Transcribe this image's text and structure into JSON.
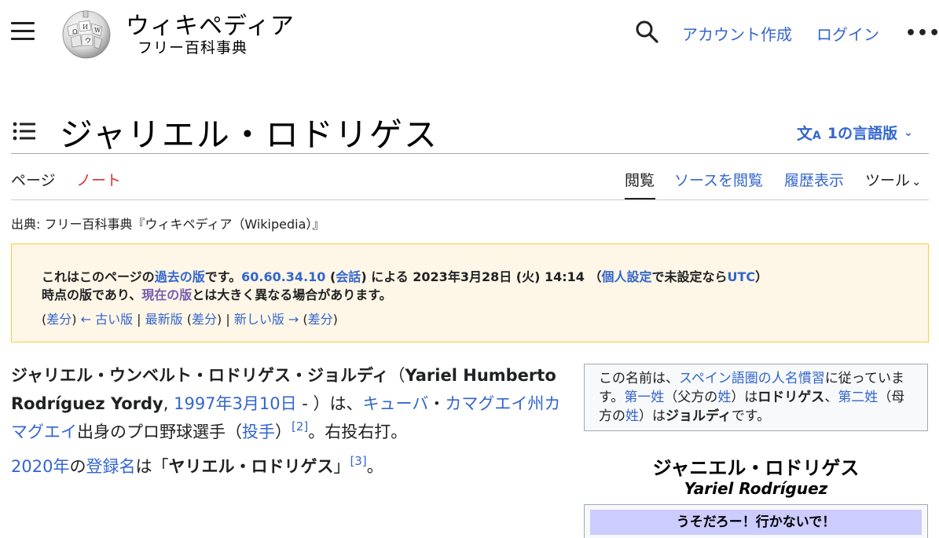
{
  "header": {
    "wordmark": "ウィキペディア",
    "tagline": "フリー百科事典",
    "create_account": "アカウント作成",
    "login": "ログイン",
    "more": "•••"
  },
  "page": {
    "title": "ジャリエル・ロドリゲス",
    "languages": "1の言語版"
  },
  "tabs": {
    "page": "ページ",
    "talk": "ノート",
    "read": "閲覧",
    "view_source": "ソースを閲覧",
    "history": "履歴表示",
    "tools": "ツール"
  },
  "source_line": "出典: フリー百科事典『ウィキペディア（Wikipedia）』",
  "notice": {
    "l1_a": "これはこのページの",
    "l1_old_rev": "過去の版",
    "l1_b": "です。",
    "l1_ip": "60.60.34.10",
    "l1_c": " (",
    "l1_talk": "会話",
    "l1_d": ") による 2023年3月28日 (火) 14:14 （",
    "l1_prefs": "個人設定",
    "l1_e": "で未設定なら",
    "l1_utc": "UTC",
    "l1_f": "）",
    "l2_a": "時点の版であり、",
    "l2_current": "現在の版",
    "l2_b": "とは大きく異なる場合があります。",
    "nav_diff1": "差分",
    "nav_older": "← 古い版",
    "nav_latest": "最新版",
    "nav_diff2": "差分",
    "nav_newer": "新しい版 →",
    "nav_diff3": "差分"
  },
  "article": {
    "p1_name_ja": "ジャリエル・ウンベルト・ロドリゲス・ジョルディ",
    "p1_open": "（",
    "p1_name_es": "Yariel Humberto Rodríguez Yordy",
    "p1_comma": ", ",
    "p1_date": "1997年3月10日",
    "p1_after_date": " - ）は、",
    "p1_cuba": "キューバ",
    "p1_dot": "・",
    "p1_province": "カマグエイ州",
    "p1_city": "カマグエイ",
    "p1_mid": "出身のプロ野球選手（",
    "p1_pitcher": "投手",
    "p1_close": "）",
    "p1_ref": "[2]",
    "p1_end": "。右投右打。",
    "p2_year": "2020年",
    "p2_no": "の",
    "p2_reg": "登録名",
    "p2_mid": "は「",
    "p2_name": "ヤリエル・ロドリゲス",
    "p2_close": "」",
    "p2_ref": "[3]",
    "p2_end": "。"
  },
  "hatnote": {
    "a": "この名前は、",
    "link1": "スペイン語圏の人名慣習",
    "b": "に従っています。",
    "link2": "第一姓",
    "c": "（父方の",
    "link3": "姓",
    "d": "）は",
    "name1": "ロドリゲス",
    "e": "、",
    "link4": "第二姓",
    "f": "（母方の",
    "link5": "姓",
    "g": "）は",
    "name2": "ジョルディ",
    "h": "です。"
  },
  "infobox": {
    "title": "ジャニエル・ロドリゲス",
    "subtitle": "Yariel Rodríguez",
    "band": "うそだろー！行かないで！"
  },
  "colors": {
    "link": "#3366cc",
    "visited": "#795cb2",
    "red_link": "#d73333",
    "notice_bg": "#fef6e7",
    "notice_border": "#ffcc33",
    "infobox_band": "#ccccff"
  }
}
